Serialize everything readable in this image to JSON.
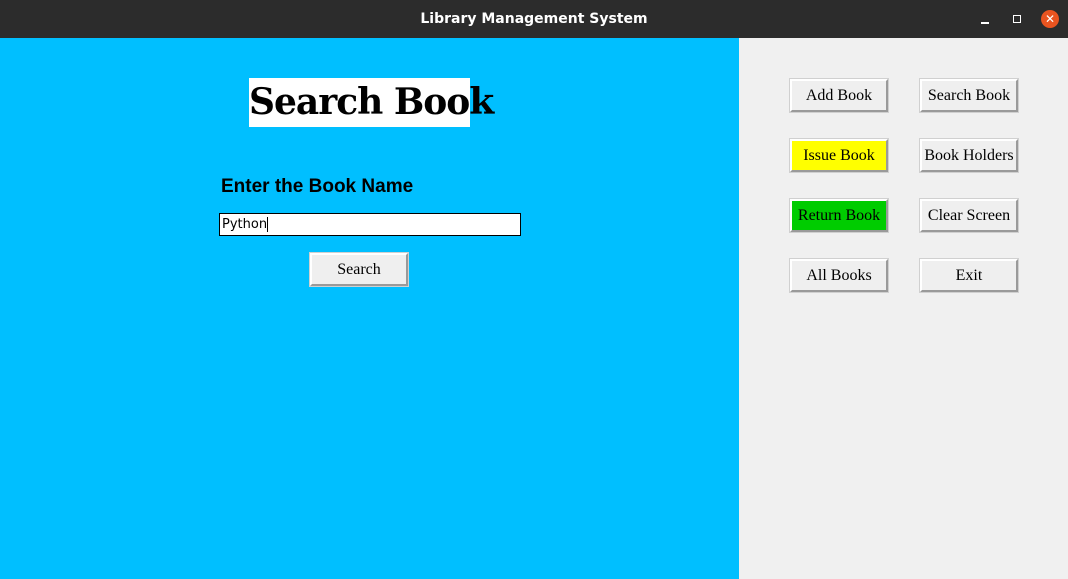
{
  "window": {
    "title": "Library Management System",
    "colors": {
      "titlebar": "#2c2c2c",
      "close_button": "#e95420"
    }
  },
  "main": {
    "background": "#00bfff",
    "heading": "Search Book",
    "prompt_label": "Enter the Book Name",
    "book_name_input": {
      "value": "Python",
      "placeholder": ""
    },
    "search_button_label": "Search"
  },
  "menu": {
    "background": "#f0f0f0",
    "buttons": [
      {
        "label": "Add Book",
        "color": "#efefef"
      },
      {
        "label": "Search Book",
        "color": "#efefef"
      },
      {
        "label": "Issue Book",
        "color": "#ffff00"
      },
      {
        "label": "Book Holders",
        "color": "#efefef"
      },
      {
        "label": "Return Book",
        "color": "#00cc00"
      },
      {
        "label": "Clear Screen",
        "color": "#efefef"
      },
      {
        "label": "All Books",
        "color": "#efefef"
      },
      {
        "label": "Exit",
        "color": "#efefef"
      }
    ]
  }
}
